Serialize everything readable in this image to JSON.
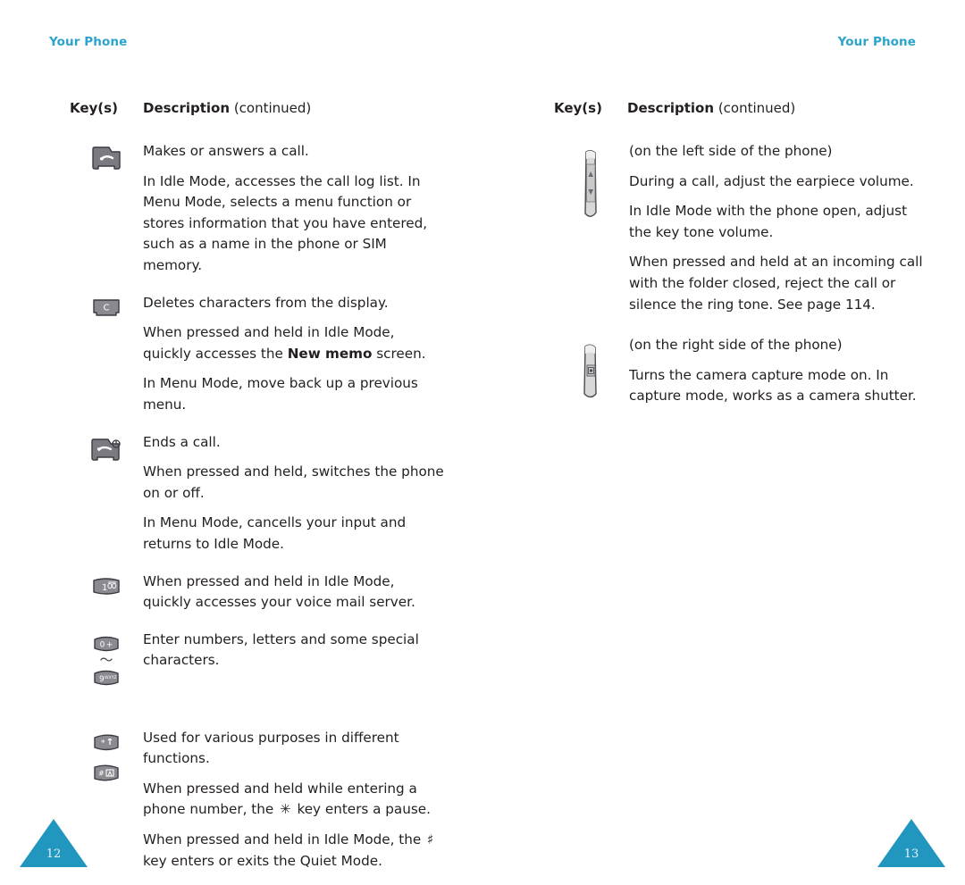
{
  "document": {
    "running_head_left": "Your Phone",
    "running_head_right": "Your Phone",
    "accent_color": "#2CA3CC",
    "page_number_color": "#2197BF",
    "text_color": "#231f20"
  },
  "left_page": {
    "page_number": "12",
    "table": {
      "header": {
        "key_column": "Key(s)",
        "description_column": "Description",
        "continued": "(continued)"
      },
      "rows": [
        {
          "key_icons": [
            "send-key"
          ],
          "paragraphs": [
            "Makes or answers a call.",
            "In Idle Mode, accesses the call log list. In Menu Mode, selects a menu function or stores information that you have entered, such as a name in the phone or SIM memory."
          ]
        },
        {
          "key_icons": [
            "clear-key"
          ],
          "paragraphs": [
            "Deletes characters from the display.",
            "When pressed and held in Idle Mode, quickly accesses the New memo screen.",
            "In Menu Mode, move back up a previous menu."
          ],
          "bold_terms": [
            "New memo"
          ]
        },
        {
          "key_icons": [
            "end-power-key"
          ],
          "paragraphs": [
            "Ends a call.",
            "When pressed and held, switches the phone on or off.",
            "In Menu Mode, cancells your input and returns to Idle Mode."
          ]
        },
        {
          "key_icons": [
            "one-voicemail-key"
          ],
          "paragraphs": [
            "When pressed and held in Idle Mode, quickly accesses your voice mail server."
          ]
        },
        {
          "key_icons": [
            "zero-plus-key",
            "tilde-separator",
            "nine-wxyz-key"
          ],
          "paragraphs": [
            "Enter numbers, letters and some special characters."
          ]
        },
        {
          "key_icons": [
            "star-key",
            "hash-key"
          ],
          "paragraphs": [
            "Used for various purposes in different functions.",
            "When pressed and held while entering a phone number, the ✳ key enters a pause.",
            "When pressed and held in Idle Mode, the ♯ key enters or exits the Quiet Mode."
          ],
          "inline_symbols": [
            "✳",
            "♯"
          ]
        }
      ]
    }
  },
  "right_page": {
    "page_number": "13",
    "table": {
      "header": {
        "key_column": "Key(s)",
        "description_column": "Description",
        "continued": "(continued)"
      },
      "rows": [
        {
          "key_icons": [
            "volume-side-key"
          ],
          "paragraphs": [
            "(on the left side of the phone)",
            "During a call, adjust the earpiece volume.",
            "In Idle Mode with the phone open, adjust the key tone volume.",
            "When pressed and held at an incoming call with the folder closed, reject the call or silence the ring tone. See page 114."
          ]
        },
        {
          "key_icons": [
            "camera-side-key"
          ],
          "paragraphs": [
            "(on the right side of the phone)",
            "Turns the camera capture mode on. In capture mode, works as a camera shutter."
          ]
        }
      ]
    }
  },
  "key_labels": {
    "one": "1",
    "zero": "0",
    "plus": "+",
    "nine": "9",
    "nine_letters": "WXYZ",
    "star": "*",
    "hash": "#",
    "clear": "C",
    "tilde": "～"
  }
}
